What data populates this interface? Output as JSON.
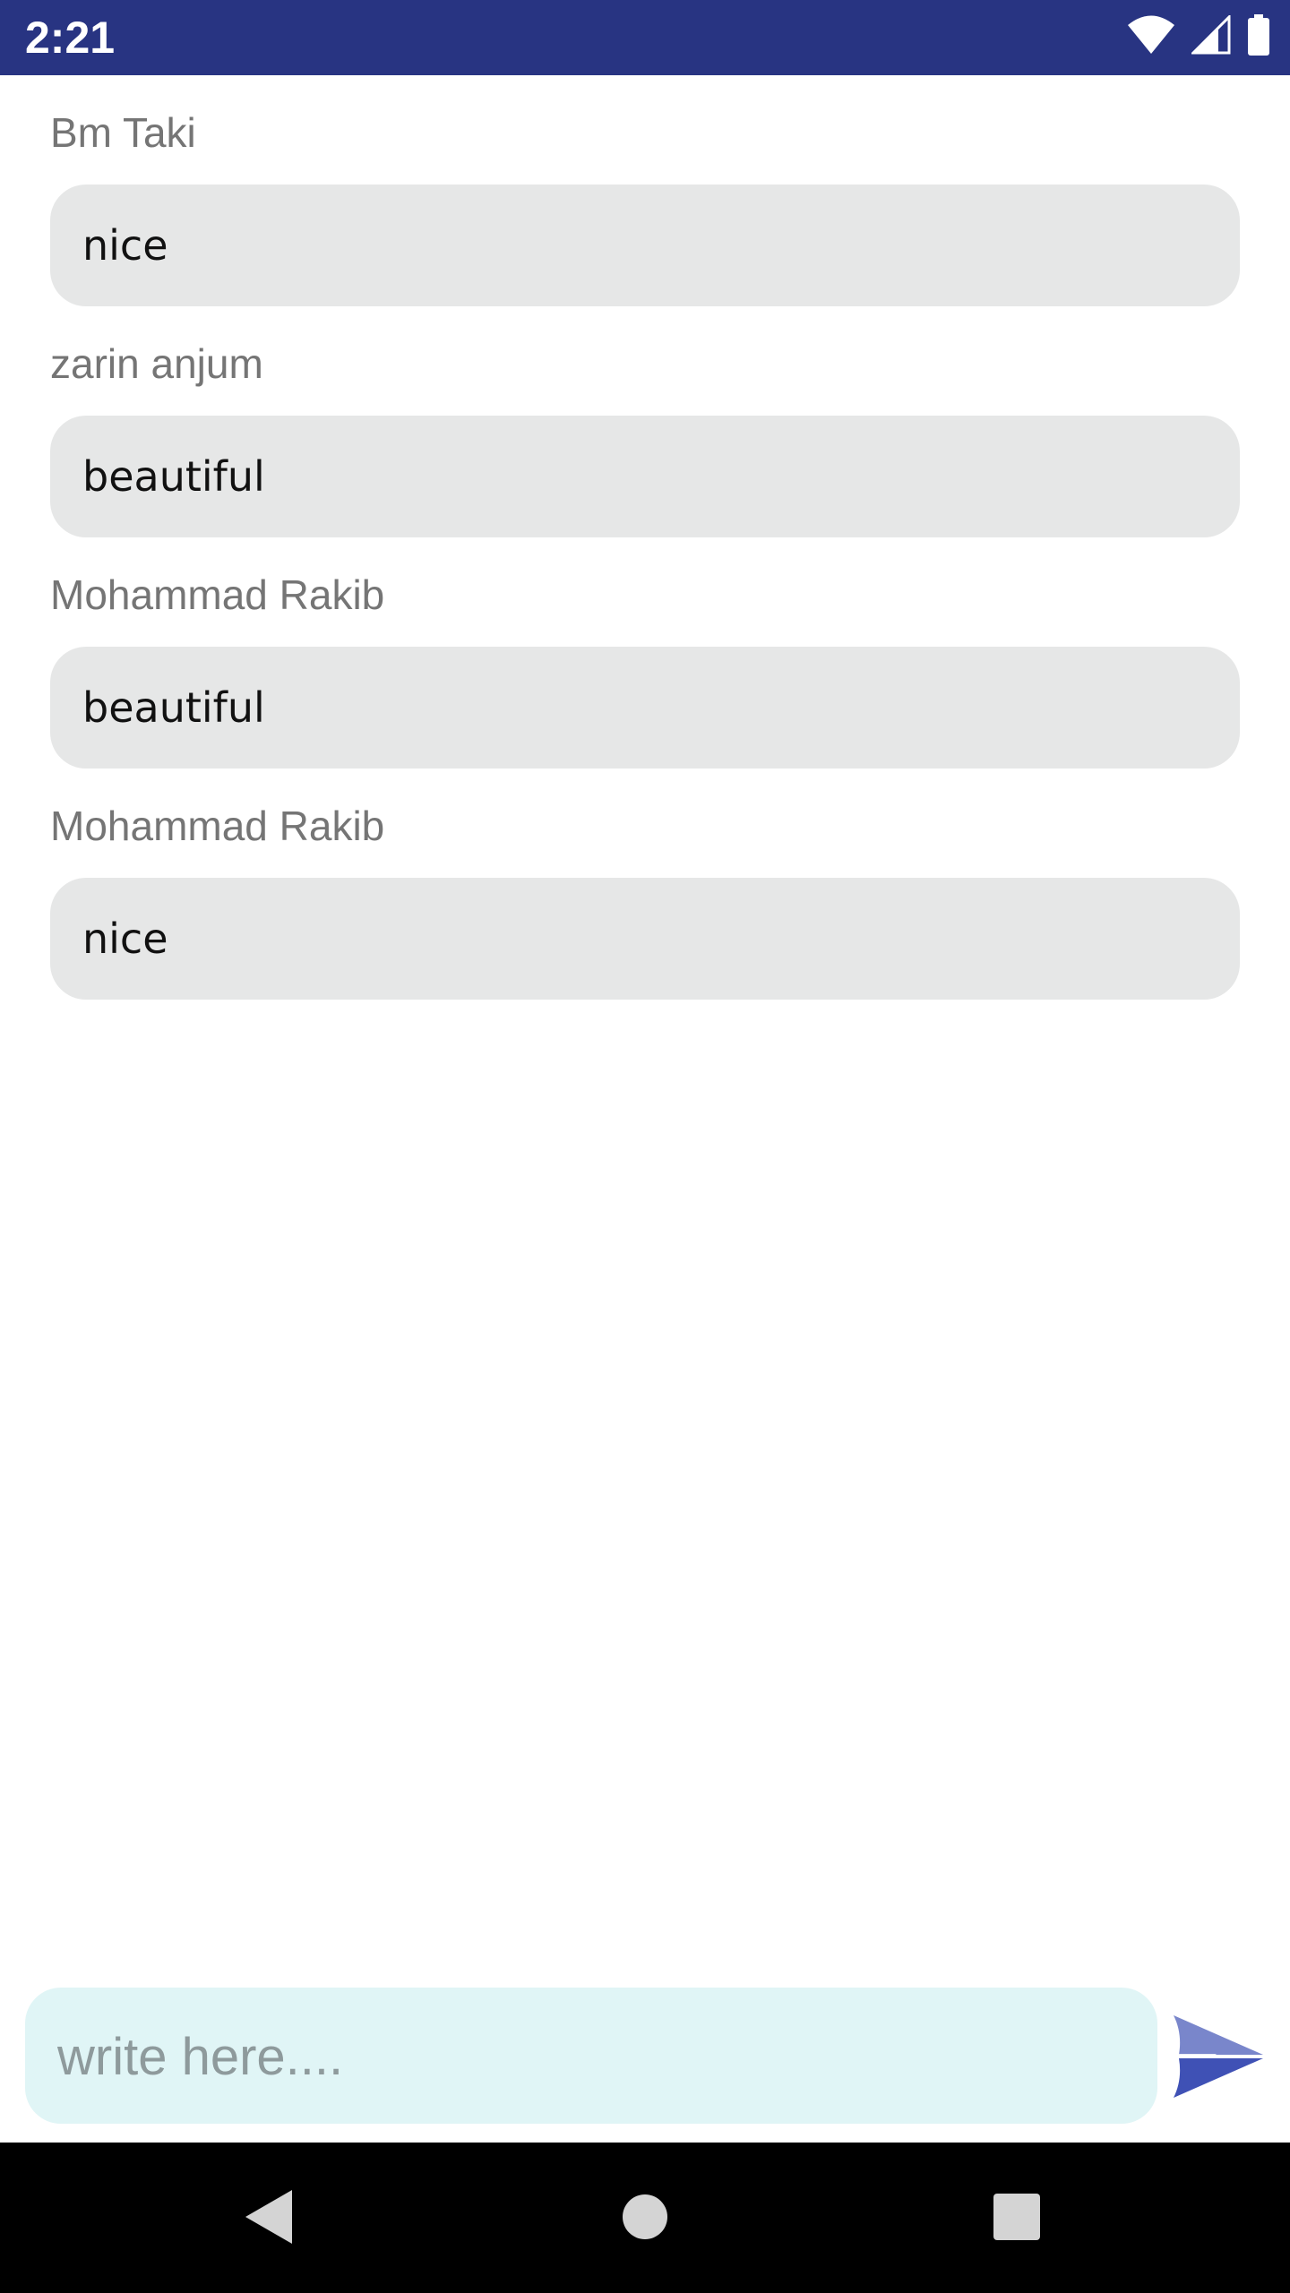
{
  "status_bar": {
    "time": "2:21",
    "icons": [
      "wifi-icon",
      "cellular-signal-icon",
      "battery-icon"
    ],
    "background": "#283482"
  },
  "messages": [
    {
      "sender": "Bm Taki",
      "text": "nice"
    },
    {
      "sender": "zarin anjum",
      "text": "beautiful"
    },
    {
      "sender": "Mohammad Rakib",
      "text": "beautiful"
    },
    {
      "sender": "Mohammad Rakib",
      "text": "nice"
    }
  ],
  "composer": {
    "placeholder": "write here....",
    "value": "",
    "send_icon": "send-icon",
    "accent": "#3f51b5"
  },
  "nav_bar": {
    "buttons": [
      "back-icon",
      "home-icon",
      "recents-icon"
    ]
  },
  "colors": {
    "bubble": "#e6e7e7",
    "composer_bg": "#e0f5f6",
    "sender_text": "#757575"
  }
}
